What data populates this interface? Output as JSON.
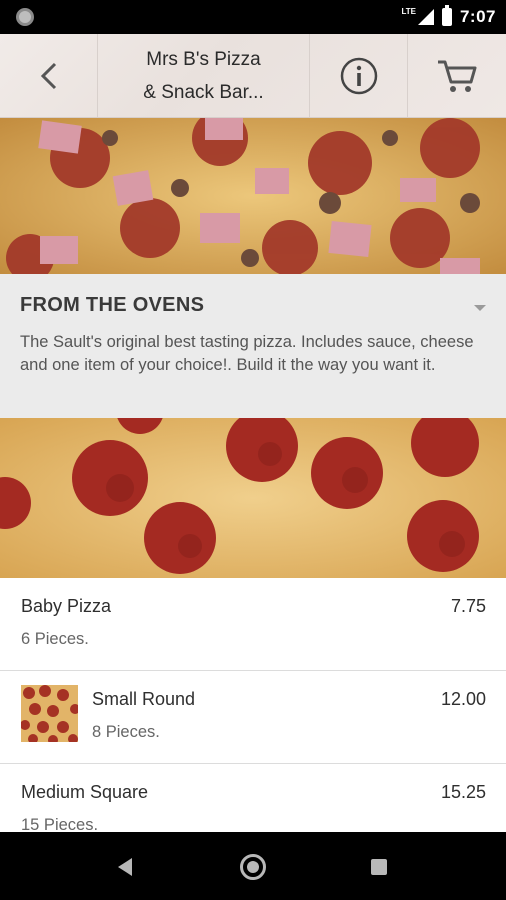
{
  "status_bar": {
    "network": "LTE",
    "time": "7:07"
  },
  "app_bar": {
    "title_line1": "Mrs B's Pizza",
    "title_line2": "& Snack Bar...",
    "back_icon": "chevron-left-icon",
    "info_icon": "info-icon",
    "cart_icon": "cart-icon"
  },
  "category": {
    "title": "FROM THE OVENS",
    "description": "The Sault's original best tasting pizza. Includes sauce, cheese and one item of your choice!. Build it the way you want it.",
    "expand_icon": "caret-down-icon"
  },
  "menu_items": [
    {
      "name": "Baby Pizza",
      "description": "6 Pieces.",
      "price": "7.75",
      "has_thumb": false
    },
    {
      "name": "Small Round",
      "description": "8 Pieces.",
      "price": "12.00",
      "has_thumb": true
    },
    {
      "name": "Medium Square",
      "description": "15 Pieces.",
      "price": "15.25",
      "has_thumb": false
    }
  ],
  "nav_bar": {
    "back_icon": "nav-back-icon",
    "home_icon": "nav-home-icon",
    "recents_icon": "nav-recents-icon"
  }
}
